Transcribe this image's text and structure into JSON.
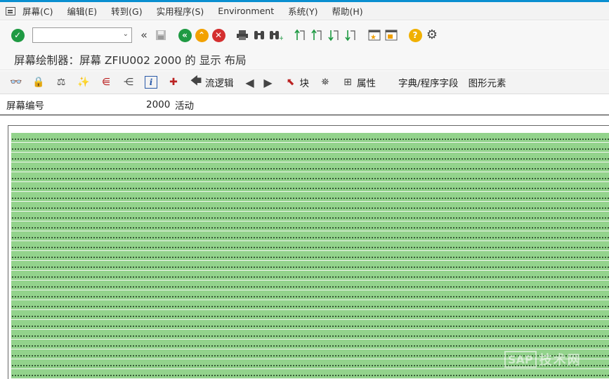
{
  "colors": {
    "accent": "#0a8fd0",
    "canvas_green": "#93d38c",
    "confirm_green": "#1f9a43",
    "cancel_red": "#d42f2f",
    "help_yellow": "#f0b000"
  },
  "menubar": {
    "items": [
      "屏幕(C)",
      "编辑(E)",
      "转到(G)",
      "实用程序(S)",
      "Environment",
      "系统(Y)",
      "帮助(H)"
    ]
  },
  "toolbar": {
    "command_field_value": "",
    "icons": [
      "check-icon",
      "double-chevron-left-icon",
      "save-icon",
      "back-icon",
      "exit-icon",
      "cancel-icon",
      "print-icon",
      "find-icon",
      "find-next-icon",
      "first-page-icon",
      "previous-page-icon",
      "next-page-icon",
      "last-page-icon",
      "create-session-icon",
      "shortcut-icon",
      "help-icon",
      "settings-icon"
    ]
  },
  "title": "屏幕绘制器：屏幕 ZFIU002 2000 的 显示 布局",
  "apptoolbar": {
    "flow_logic": "流逻辑",
    "block": "块",
    "attributes": "属性",
    "dict_fields": "字典/程序字段",
    "graphic_elements": "图形元素"
  },
  "screen": {
    "label": "屏幕编号",
    "number": "2000",
    "status": "活动"
  },
  "watermark": {
    "logo": "SAP",
    "text": "技术网"
  }
}
